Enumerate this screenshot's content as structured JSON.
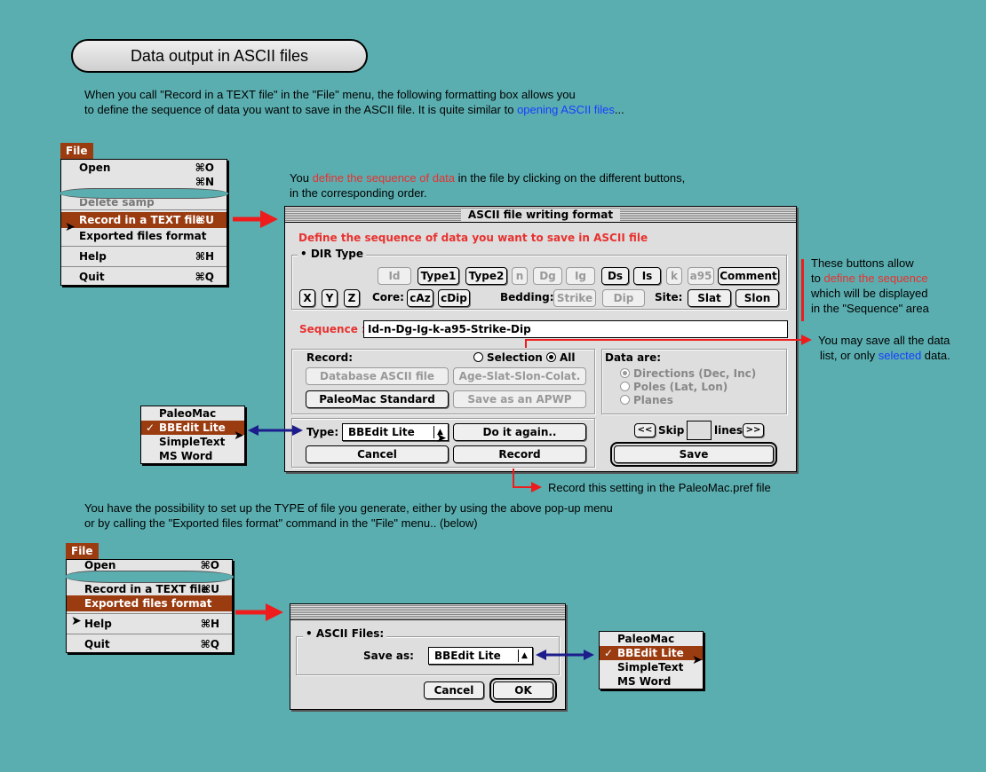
{
  "page_title": "Data output in ASCII files",
  "intro": {
    "line1": "When you call \"Record in a TEXT file\" in the \"File\" menu, the following formatting box allows you",
    "line2_a": "to define the sequence of data you want to save in the ASCII file. It is quite similar to ",
    "line2_link": "opening ASCII files",
    "line2_b": "..."
  },
  "note_sequence": {
    "a": "You ",
    "red": "define the sequence of data",
    "b": " in the file by clicking on the different buttons,",
    "line2": "in the corresponding order."
  },
  "file_menu_1": {
    "title": "File",
    "items": [
      {
        "label": "Open",
        "shortcut": "⌘O"
      },
      {
        "label": "",
        "shortcut": "⌘N"
      },
      {
        "label": "Delete samp",
        "shortcut": ""
      },
      {
        "label": "Record in a TEXT file",
        "shortcut": "⌘U"
      },
      {
        "label": "Exported files format",
        "shortcut": ""
      },
      {
        "label": "Help",
        "shortcut": "⌘H"
      },
      {
        "label": "Quit",
        "shortcut": "⌘Q"
      }
    ]
  },
  "dialog1": {
    "title": "ASCII file writing format",
    "heading": "Define the sequence of data you want to save in ASCII file",
    "dir_type_label": "• DIR Type",
    "row1_buttons": [
      "Id",
      "Type1",
      "Type2",
      "n",
      "Dg",
      "Ig",
      "Ds",
      "Is",
      "k",
      "a95",
      "Comment"
    ],
    "row2_xyz": [
      "X",
      "Y",
      "Z"
    ],
    "core_label": "Core:",
    "core_buttons": [
      "cAz",
      "cDip"
    ],
    "bedding_label": "Bedding:",
    "bedding_buttons": [
      "Strike",
      "Dip"
    ],
    "site_label": "Site:",
    "site_buttons": [
      "Slat",
      "Slon"
    ],
    "sequence_label": "Sequence :",
    "sequence_value": "Id-n-Dg-Ig-k-a95-Strike-Dip",
    "record_label": "Record:",
    "radio_selection": "Selection",
    "radio_all": "All",
    "btn_database": "Database ASCII file",
    "btn_age": "Age-Slat-Slon-Colat.",
    "btn_paleomac": "PaleoMac Standard",
    "btn_apwp": "Save as an APWP",
    "data_are_label": "Data are:",
    "data_options": [
      "Directions (Dec, Inc)",
      "Poles (Lat, Lon)",
      "Planes"
    ],
    "type_label": "Type:",
    "type_value": "BBEdit Lite",
    "btn_again": "Do it again..",
    "btn_cancel": "Cancel",
    "btn_record": "Record",
    "skip_prev": "<<",
    "skip_label": "Skip",
    "skip_value": "",
    "lines_label": "lines",
    "skip_next": ">>",
    "btn_save": "Save"
  },
  "note_buttons": {
    "line1": "These buttons allow",
    "line2_a": "to ",
    "line2_red": "define the sequence",
    "line3": "which will be displayed",
    "line4": "in the \"Sequence\" area"
  },
  "note_save": {
    "line1": "You may save all the data",
    "line2_a": "list, or only ",
    "line2_blue": "selected",
    "line2_b": " data."
  },
  "note_record": "Record this setting in the PaleoMac.pref file",
  "popup_list_1": {
    "items": [
      "PaleoMac",
      "BBEdit Lite",
      "SimpleText",
      "MS Word"
    ],
    "selected": "BBEdit Lite"
  },
  "para2": {
    "line1": "You have the possibility to set up the TYPE of file you generate, either by using the above pop-up menu",
    "line2": "or by calling the \"Exported files format\" command in the \"File\" menu.. (below)"
  },
  "file_menu_2": {
    "title": "File",
    "items": [
      {
        "label": "Open",
        "shortcut": "⌘O"
      },
      {
        "label": "Record in a TEXT file",
        "shortcut": "⌘U"
      },
      {
        "label": "Exported files format",
        "shortcut": ""
      },
      {
        "label": "Help",
        "shortcut": "⌘H"
      },
      {
        "label": "Quit",
        "shortcut": "⌘Q"
      }
    ]
  },
  "dialog2": {
    "group_label": "• ASCII Files:",
    "save_as_label": "Save as:",
    "save_as_value": "BBEdit Lite",
    "btn_cancel": "Cancel",
    "btn_ok": "OK"
  },
  "popup_list_2": {
    "items": [
      "PaleoMac",
      "BBEdit Lite",
      "SimpleText",
      "MS Word"
    ],
    "selected": "BBEdit Lite"
  },
  "colors": {
    "background": "#5aaeb0",
    "menu_highlight": "#9b3b10",
    "red_arrow": "#ee1c1c",
    "blue_arrow": "#1c1c8c",
    "red_text": "#e8312f",
    "blue_link": "#1a3cff"
  }
}
